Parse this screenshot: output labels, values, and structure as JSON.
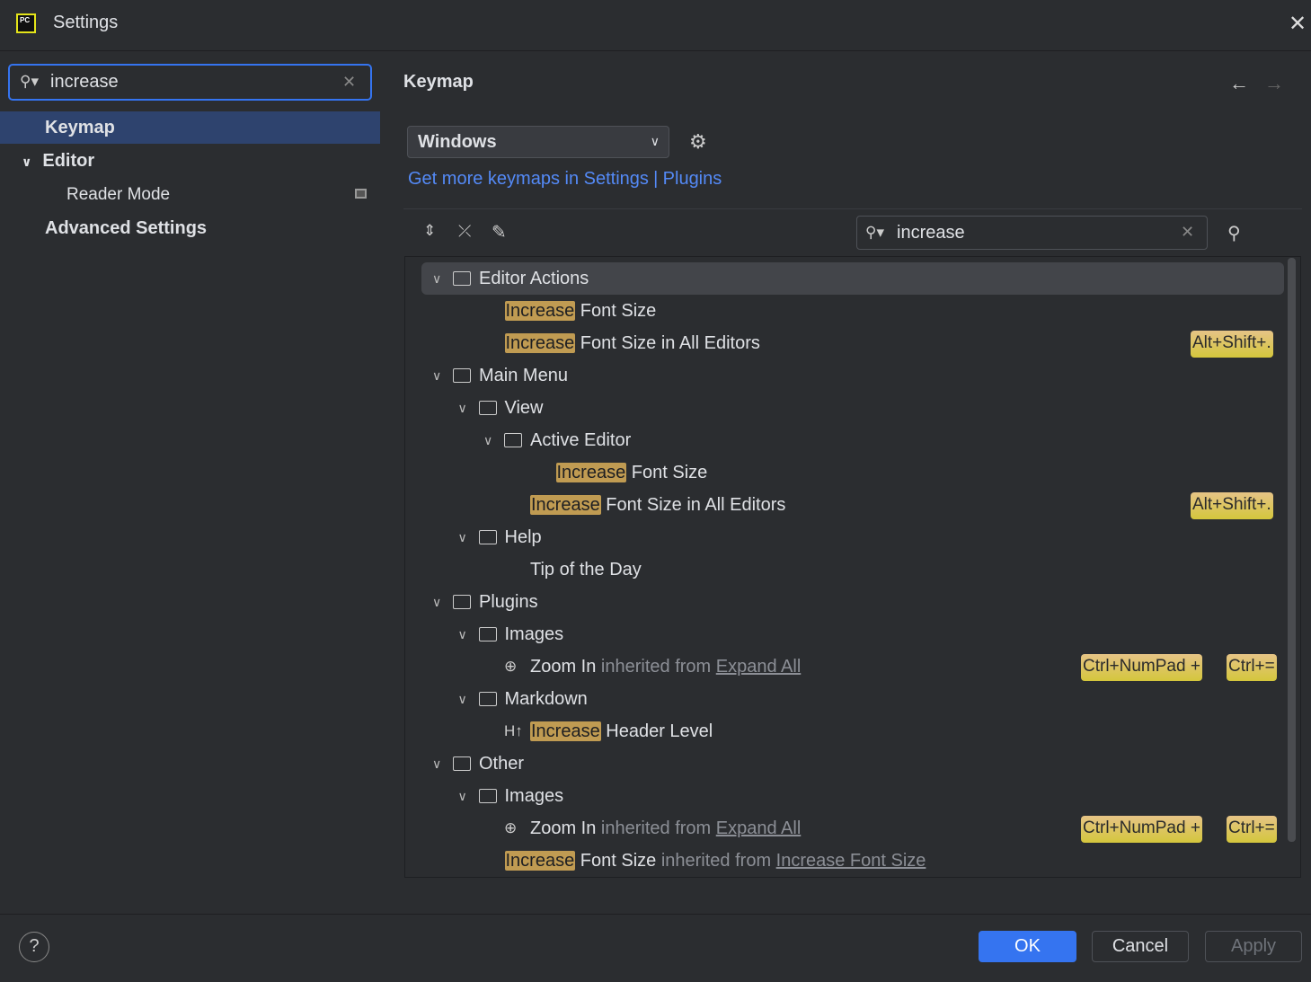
{
  "window": {
    "title": "Settings",
    "logo": "PC",
    "close_icon": "close-icon"
  },
  "sidebar": {
    "search_value": "increase",
    "items": [
      {
        "label": "Keymap",
        "selected": true
      },
      {
        "label": "Editor",
        "expanded": true
      },
      {
        "label": "Reader Mode"
      },
      {
        "label": "Advanced Settings"
      }
    ]
  },
  "main": {
    "title": "Keymap",
    "keymap_select": "Windows",
    "link_settings": "Get more keymaps in Settings",
    "link_sep": "|",
    "link_plugins": "Plugins",
    "search_value": "increase",
    "tree": [
      {
        "depth": 0,
        "folder": true,
        "label": "Editor Actions",
        "selected": true
      },
      {
        "depth": 1,
        "hl": "Increase",
        "label": " Font Size"
      },
      {
        "depth": 1,
        "hl": "Increase",
        "label": " Font Size in All Editors",
        "shortcuts": [
          "Alt+Shift+."
        ]
      },
      {
        "depth": 0,
        "folder": true,
        "label": "Main Menu"
      },
      {
        "depth": 1,
        "folder": true,
        "label": "View"
      },
      {
        "depth": 2,
        "folder": true,
        "label": "Active Editor"
      },
      {
        "depth": 3,
        "hl": "Increase",
        "label": " Font Size"
      },
      {
        "depth": 2,
        "hl": "Increase",
        "label": " Font Size in All Editors",
        "shortcuts": [
          "Alt+Shift+."
        ]
      },
      {
        "depth": 1,
        "folder": true,
        "label": "Help"
      },
      {
        "depth": 2,
        "label": "Tip of the Day"
      },
      {
        "depth": 0,
        "folder": true,
        "label": "Plugins"
      },
      {
        "depth": 1,
        "folder": true,
        "label": "Images"
      },
      {
        "depth": 2,
        "icon": "⊕",
        "label": "Zoom In",
        "inherited": " inherited from ",
        "from": "Expand All",
        "shortcuts": [
          "Ctrl+NumPad +",
          "Ctrl+="
        ]
      },
      {
        "depth": 1,
        "folder": true,
        "label": "Markdown"
      },
      {
        "depth": 2,
        "icon": "H↑",
        "hl": "Increase",
        "label": " Header Level"
      },
      {
        "depth": 0,
        "folder": true,
        "label": "Other"
      },
      {
        "depth": 1,
        "folder": true,
        "label": "Images"
      },
      {
        "depth": 2,
        "icon": "⊕",
        "label": "Zoom In",
        "inherited": " inherited from ",
        "from": "Expand All",
        "shortcuts": [
          "Ctrl+NumPad +",
          "Ctrl+="
        ]
      },
      {
        "depth": 1,
        "hl": "Increase",
        "label": " Font Size",
        "inherited": " inherited from ",
        "from": "Increase Font Size"
      }
    ]
  },
  "footer": {
    "help": "?",
    "ok": "OK",
    "cancel": "Cancel",
    "apply": "Apply"
  },
  "colors": {
    "accent": "#3574f0",
    "highlight": "#c09b52",
    "shortcut": "#d4c63c"
  }
}
